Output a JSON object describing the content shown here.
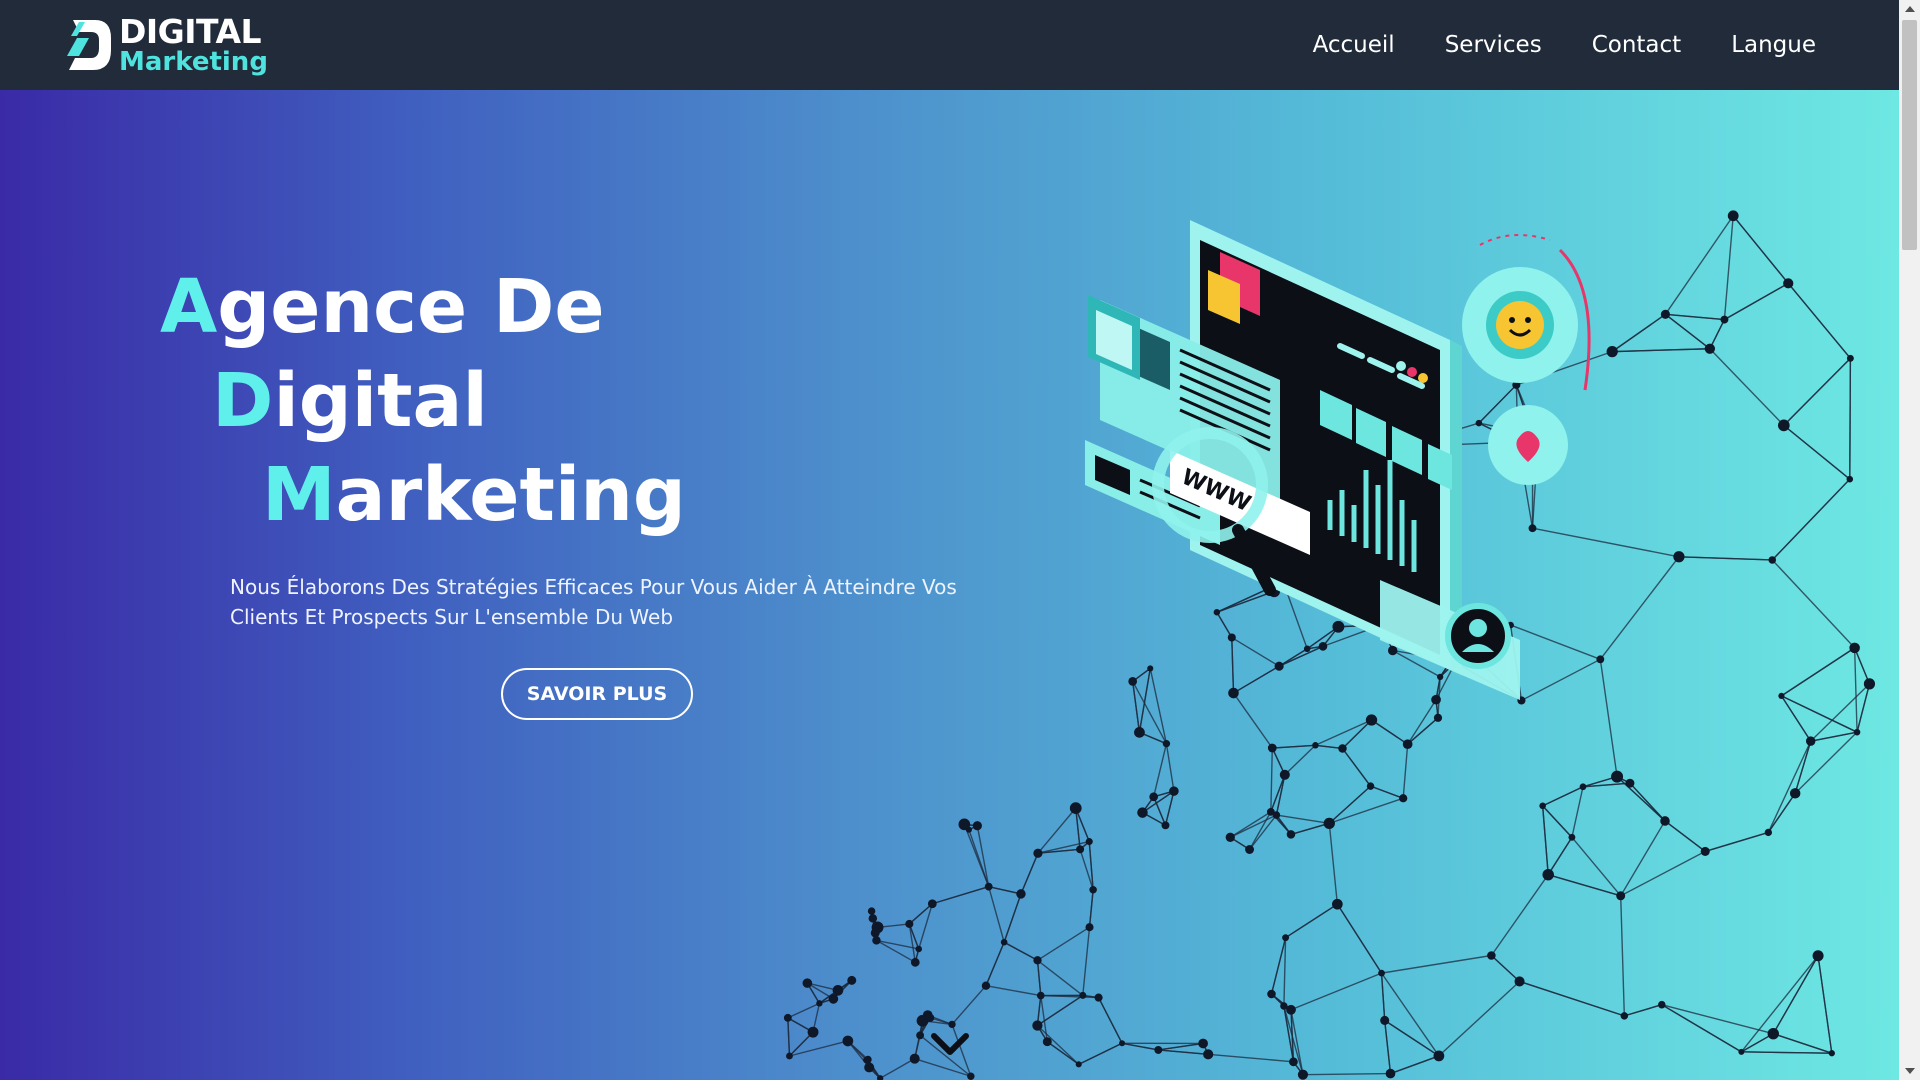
{
  "logo": {
    "word1": "DIGITAL",
    "word2": "Marketing",
    "mark_icon": "d-logo-icon"
  },
  "nav": {
    "items": [
      {
        "label": "Accueil"
      },
      {
        "label": "Services"
      },
      {
        "label": "Contact"
      },
      {
        "label": "Langue"
      }
    ]
  },
  "hero": {
    "title": {
      "line1_initial": "A",
      "line1_rest": "gence De",
      "line2_initial": "D",
      "line2_rest": "igital",
      "line3_initial": "M",
      "line3_rest": "arketing"
    },
    "subtitle": "Nous Élaborons Des Stratégies Efficaces Pour Vous Aider À Atteindre Vos Clients Et Prospects Sur L'ensemble Du Web",
    "cta_label": "SAVOIR PLUS",
    "illustration_icon": "digital-dashboard-illustration",
    "illustration_text": "WWW",
    "scroll_icon": "chevron-down-icon"
  },
  "colors": {
    "header_bg": "#212b3a",
    "accent": "#5ff0ec",
    "gradient_start": "#3a2aa6",
    "gradient_end": "#6ee8e3"
  }
}
